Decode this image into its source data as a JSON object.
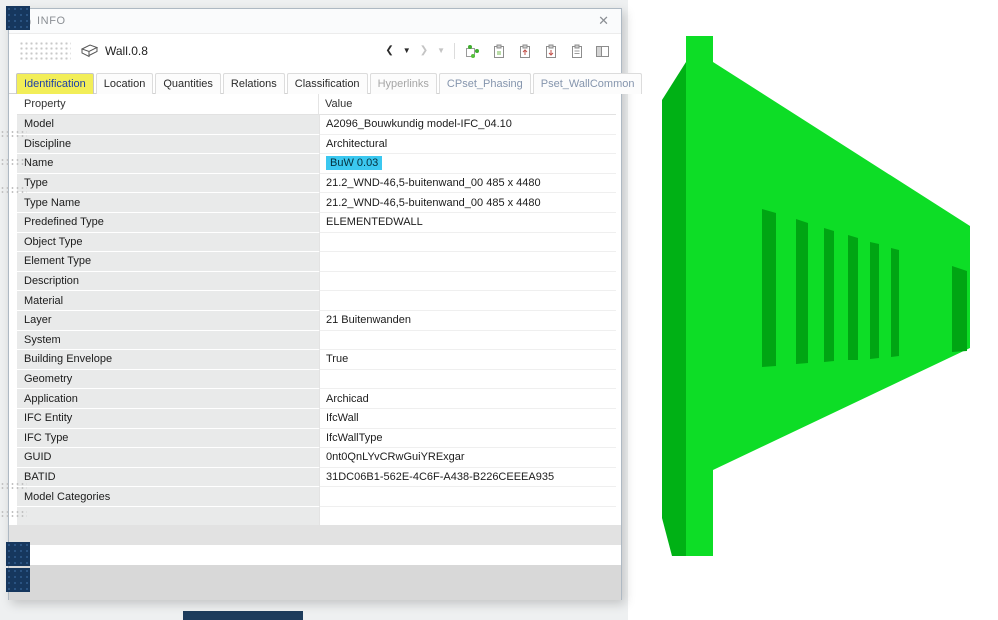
{
  "window": {
    "icon": "ⓘ",
    "title": "INFO",
    "close_icon": "✕"
  },
  "toolbar": {
    "object_label": "Wall.0.8",
    "icons": {
      "prev": "❮",
      "prev_dd": "▼",
      "next": "❯",
      "next_dd": "▼"
    }
  },
  "tabs": [
    {
      "label": "Identification",
      "state": "active"
    },
    {
      "label": "Location",
      "state": "normal"
    },
    {
      "label": "Quantities",
      "state": "normal"
    },
    {
      "label": "Relations",
      "state": "normal"
    },
    {
      "label": "Classification",
      "state": "normal"
    },
    {
      "label": "Hyperlinks",
      "state": "disabled"
    },
    {
      "label": "CPset_Phasing",
      "state": "pset"
    },
    {
      "label": "Pset_WallCommon",
      "state": "pset"
    }
  ],
  "table": {
    "columns": [
      "Property",
      "Value"
    ],
    "rows": [
      {
        "property": "Model",
        "value": "A2096_Bouwkundig model-IFC_04.10"
      },
      {
        "property": "Discipline",
        "value": "Architectural"
      },
      {
        "property": "Name",
        "value": "BuW 0.03",
        "highlight": true
      },
      {
        "property": "Type",
        "value": "21.2_WND-46,5-buitenwand_00 485 x 4480"
      },
      {
        "property": "Type Name",
        "value": "21.2_WND-46,5-buitenwand_00 485 x 4480"
      },
      {
        "property": "Predefined Type",
        "value": "ELEMENTEDWALL"
      },
      {
        "property": "Object Type",
        "value": ""
      },
      {
        "property": "Element Type",
        "value": ""
      },
      {
        "property": "Description",
        "value": ""
      },
      {
        "property": "Material",
        "value": ""
      },
      {
        "property": "Layer",
        "value": "21 Buitenwanden"
      },
      {
        "property": "System",
        "value": ""
      },
      {
        "property": "Building Envelope",
        "value": "True"
      },
      {
        "property": "Geometry",
        "value": ""
      },
      {
        "property": "Application",
        "value": "Archicad"
      },
      {
        "property": "IFC Entity",
        "value": "IfcWall"
      },
      {
        "property": "IFC Type",
        "value": "IfcWallType"
      },
      {
        "property": "GUID",
        "value": "0nt0QnLYvCRwGuiYRExgar"
      },
      {
        "property": "BATID",
        "value": "31DC06B1-562E-4C6F-A438-B226CEEEA935"
      },
      {
        "property": "Model Categories",
        "value": ""
      }
    ]
  },
  "colors": {
    "highlight_cyan": "#3bc8f0",
    "tab_highlight_yellow": "#f2ee58",
    "wall_green_front": "#0ddd26",
    "wall_green_side": "#00b115",
    "wall_green_window": "#00a513"
  }
}
